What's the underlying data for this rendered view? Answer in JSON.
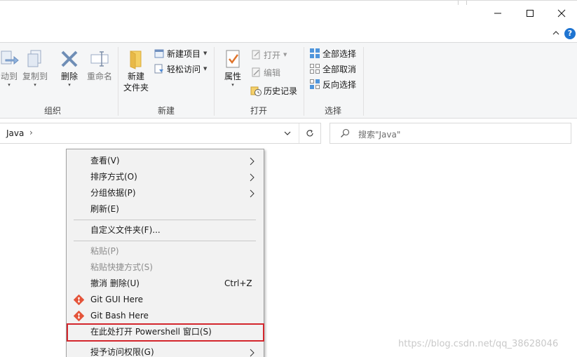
{
  "ribbon": {
    "groups": {
      "organize": {
        "label": "组织",
        "move_to": "动到",
        "copy_to": "复制到",
        "delete": "删除",
        "rename": "重命名"
      },
      "new": {
        "label": "新建",
        "new_folder_line1": "新建",
        "new_folder_line2": "文件夹",
        "new_item": "新建项目",
        "easy_access": "轻松访问"
      },
      "open": {
        "label": "打开",
        "properties": "属性",
        "open": "打开",
        "edit": "编辑",
        "history": "历史记录"
      },
      "select": {
        "label": "选择",
        "select_all": "全部选择",
        "select_none": "全部取消",
        "invert": "反向选择"
      }
    },
    "help_label": "?"
  },
  "address": {
    "crumb": "Java",
    "separator": "›"
  },
  "search": {
    "placeholder": "搜索\"Java\""
  },
  "context_menu": {
    "view": "查看(V)",
    "sort_by": "排序方式(O)",
    "group_by": "分组依据(P)",
    "refresh": "刷新(E)",
    "customize": "自定义文件夹(F)...",
    "paste": "粘贴(P)",
    "paste_shortcut": "粘贴快捷方式(S)",
    "undo": "撤消 删除(U)",
    "undo_shortcut": "Ctrl+Z",
    "git_gui": "Git GUI Here",
    "git_bash": "Git Bash Here",
    "powershell": "在此处打开 Powershell 窗口(S)",
    "give_access": "授予访问权限(G)"
  },
  "watermark": "https://blog.csdn.net/qq_38628046",
  "colors": {
    "highlight_border": "#d3262d",
    "help_blue": "#1e74d1",
    "ribbon_bg": "#f5f6f7",
    "menu_bg": "#f2f2f2"
  }
}
